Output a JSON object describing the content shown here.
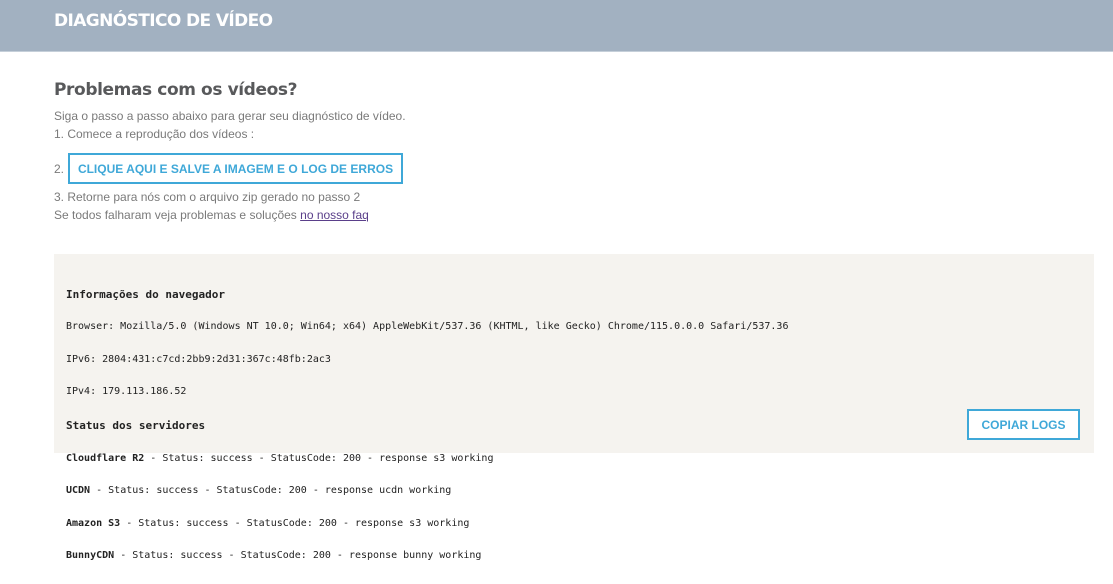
{
  "header": {
    "title": "DIAGNÓSTICO DE VÍDEO"
  },
  "main": {
    "title": "Problemas com os vídeos?",
    "intro": "Siga o passo a passo abaixo para gerar seu diagnóstico de vídeo.",
    "step1": "1. Comece a reprodução dos vídeos :",
    "step2_number": "2.",
    "step2_button": "CLIQUE AQUI E SALVE A IMAGEM E O LOG DE ERROS",
    "step3": "3. Retorne para nós com o arquivo zip gerado no passo 2",
    "faq_text": "Se todos falharam veja problemas e soluções ",
    "faq_link": "no nosso faq"
  },
  "log": {
    "browser_heading": "Informações do navegador",
    "browser_line": "Browser: Mozilla/5.0 (Windows NT 10.0; Win64; x64) AppleWebKit/537.36 (KHTML, like Gecko) Chrome/115.0.0.0 Safari/537.36",
    "ipv6_line": "IPv6: 2804:431:c7cd:2bb9:2d31:367c:48fb:2ac3",
    "ipv4_line": "IPv4: 179.113.186.52",
    "servers_heading": "Status dos servidores",
    "servers": [
      {
        "name": "Cloudflare R2",
        "status": " - Status: success - StatusCode: 200 - response s3 working"
      },
      {
        "name": "UCDN",
        "status": " - Status: success - StatusCode: 200 - response ucdn working"
      },
      {
        "name": "Amazon S3",
        "status": " - Status: success - StatusCode: 200 - response s3 working"
      },
      {
        "name": "BunnyCDN",
        "status": " - Status: success - StatusCode: 200 - response bunny working"
      }
    ],
    "copy_button": "COPIAR LOGS"
  },
  "colors": {
    "header_bg": "#a2b1c1",
    "accent": "#3fa8d8",
    "log_bg": "#f5f3ef",
    "link": "#5a3f8a"
  }
}
